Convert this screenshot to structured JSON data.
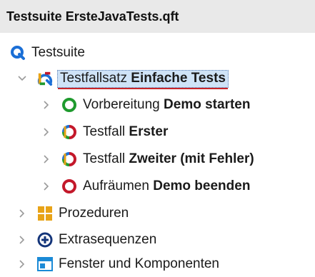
{
  "header": {
    "title": "Testsuite ErsteJavaTests.qft"
  },
  "tree": {
    "root": {
      "label": "Testsuite",
      "icon": "testsuite-q-icon"
    },
    "testset": {
      "prefix": "Testfallsatz ",
      "name": "Einfache Tests",
      "icon": "testset-icon",
      "expanded": true
    },
    "children": [
      {
        "prefix": "Vorbereitung ",
        "name": "Demo starten",
        "icon": "setup-green-circle-icon"
      },
      {
        "prefix": "Testfall ",
        "name": "Erster",
        "icon": "testcase-icon"
      },
      {
        "prefix": "Testfall ",
        "name": "Zweiter (mit Fehler)",
        "icon": "testcase-icon"
      },
      {
        "prefix": "Aufräumen ",
        "name": "Demo beenden",
        "icon": "cleanup-red-circle-icon"
      }
    ],
    "top_nodes": [
      {
        "label": "Prozeduren",
        "icon": "procedures-icon"
      },
      {
        "label": "Extrasequenzen",
        "icon": "extras-plus-icon"
      },
      {
        "label": "Fenster und Komponenten",
        "icon": "windows-icon"
      }
    ]
  },
  "colors": {
    "selection_bg": "#cfe3f7",
    "header_bg": "#e9e9e9",
    "accent_blue": "#1b6fd6",
    "green": "#1f9a2e",
    "red": "#c3182a",
    "orange": "#e8a317"
  }
}
